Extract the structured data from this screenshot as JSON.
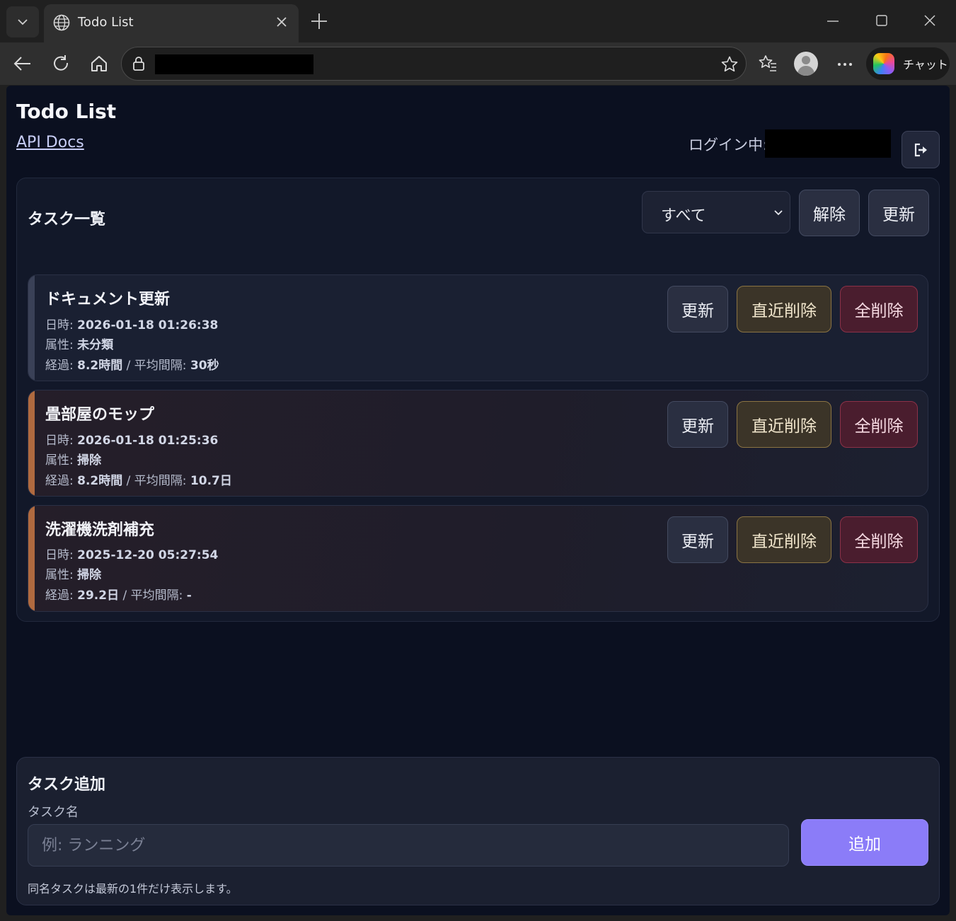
{
  "browser": {
    "tab_title": "Todo List",
    "chat_label": "チャット"
  },
  "app": {
    "title": "Todo List",
    "api_docs_link": "API Docs",
    "login_label": "ログイン中: "
  },
  "task_list": {
    "title": "タスク一覧",
    "filter": {
      "selected": "すべて"
    },
    "clear_button": "解除",
    "refresh_button": "更新",
    "labels": {
      "datetime": "日時: ",
      "category": "属性: ",
      "elapsed": "経過: ",
      "avg_interval": " / 平均間隔: "
    },
    "item_buttons": {
      "update": "更新",
      "delete_latest": "直近削除",
      "delete_all": "全削除"
    },
    "items": [
      {
        "name": "ドキュメント更新",
        "datetime": "2026-01-18 01:26:38",
        "category": "未分類",
        "elapsed": "8.2時間",
        "avg_interval": "30秒",
        "accent_color": "#3a4157"
      },
      {
        "name": "畳部屋のモップ",
        "datetime": "2026-01-18 01:25:36",
        "category": "掃除",
        "elapsed": "8.2時間",
        "avg_interval": "10.7日",
        "accent_color": "#b06a3f"
      },
      {
        "name": "洗濯機洗剤補充",
        "datetime": "2025-12-20 05:27:54",
        "category": "掃除",
        "elapsed": "29.2日",
        "avg_interval": "-",
        "accent_color": "#b06a3f"
      }
    ]
  },
  "add_task": {
    "title": "タスク追加",
    "name_label": "タスク名",
    "name_placeholder": "例: ランニング",
    "name_value": "",
    "submit_button": "追加",
    "note": "同名タスクは最新の1件だけ表示します。"
  }
}
